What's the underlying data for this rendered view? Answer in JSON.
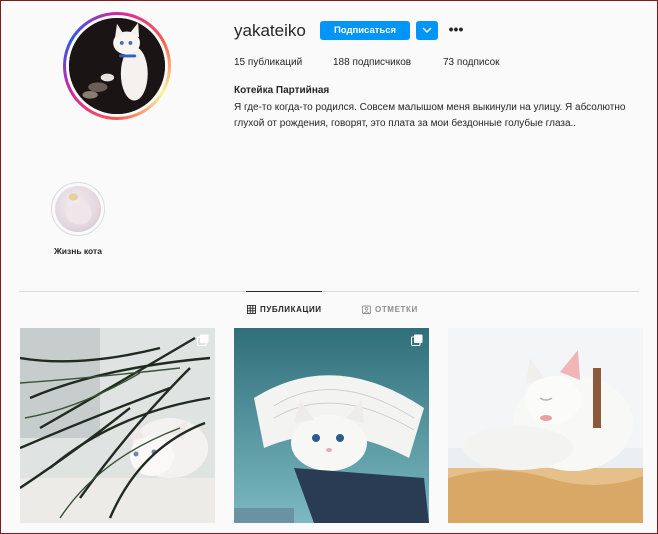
{
  "profile": {
    "username": "yakateiko",
    "follow_label": "Подписаться",
    "more_label": "•••",
    "stats": {
      "posts": "15 публикаций",
      "followers": "188 подписчиков",
      "following": "73 подписок"
    },
    "full_name": "Котейка Партийная",
    "bio": "Я где-то когда-то родился. Совсем малышом меня выкинули на улицу. Я абсолютно глухой от рождения, говорят, это плата за мои бездонные голубые глаза.."
  },
  "highlights": [
    {
      "label": "Жизнь кота"
    }
  ],
  "tabs": [
    {
      "label": "ПУБЛИКАЦИИ",
      "icon": "grid-icon",
      "active": true
    },
    {
      "label": "ОТМЕТКИ",
      "icon": "tag-icon",
      "active": false
    }
  ],
  "posts": [
    {
      "subject": "white cat under plant leaves",
      "multi": true
    },
    {
      "subject": "white cat on laptop with paper",
      "multi": true
    },
    {
      "subject": "white cat licking paw",
      "multi": false
    }
  ],
  "colors": {
    "accent": "#0095f6",
    "background": "#fafafa",
    "divider": "#dbdbdb"
  }
}
